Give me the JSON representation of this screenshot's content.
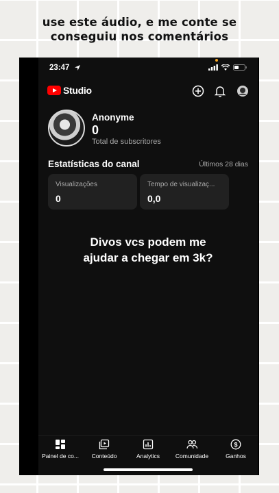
{
  "caption": {
    "line1": "use este áudio, e me conte se",
    "line2": "conseguiu nos comentários"
  },
  "status_bar": {
    "time": "23:47",
    "icons": [
      "location-arrow-icon",
      "signal-icon",
      "wifi-icon",
      "battery-icon"
    ]
  },
  "header": {
    "logo_text": "Studio",
    "icons": [
      "add-circle-icon",
      "bell-icon",
      "account-avatar-icon"
    ]
  },
  "channel": {
    "name": "Anonyme",
    "subscribers": "0",
    "subscribers_label": "Total de subscritores"
  },
  "stats": {
    "title": "Estatísticas do canal",
    "period": "Últimos 28 dias",
    "cards": [
      {
        "label": "Visualizações",
        "value": "0"
      },
      {
        "label": "Tempo de visualizaç...",
        "value": "0,0"
      }
    ]
  },
  "overlay": {
    "line1": "Divos vcs podem me",
    "line2": "ajudar a chegar em 3k?"
  },
  "bottom_nav": [
    {
      "label": "Painel de co...",
      "icon": "dashboard-icon"
    },
    {
      "label": "Conteúdo",
      "icon": "content-icon"
    },
    {
      "label": "Analytics",
      "icon": "analytics-icon"
    },
    {
      "label": "Comunidade",
      "icon": "community-icon"
    },
    {
      "label": "Ganhos",
      "icon": "earn-icon"
    }
  ],
  "colors": {
    "background": "#0f0f0f",
    "card": "#212121",
    "brand_red": "#ff0000",
    "muted_text": "#aaaaaa"
  }
}
